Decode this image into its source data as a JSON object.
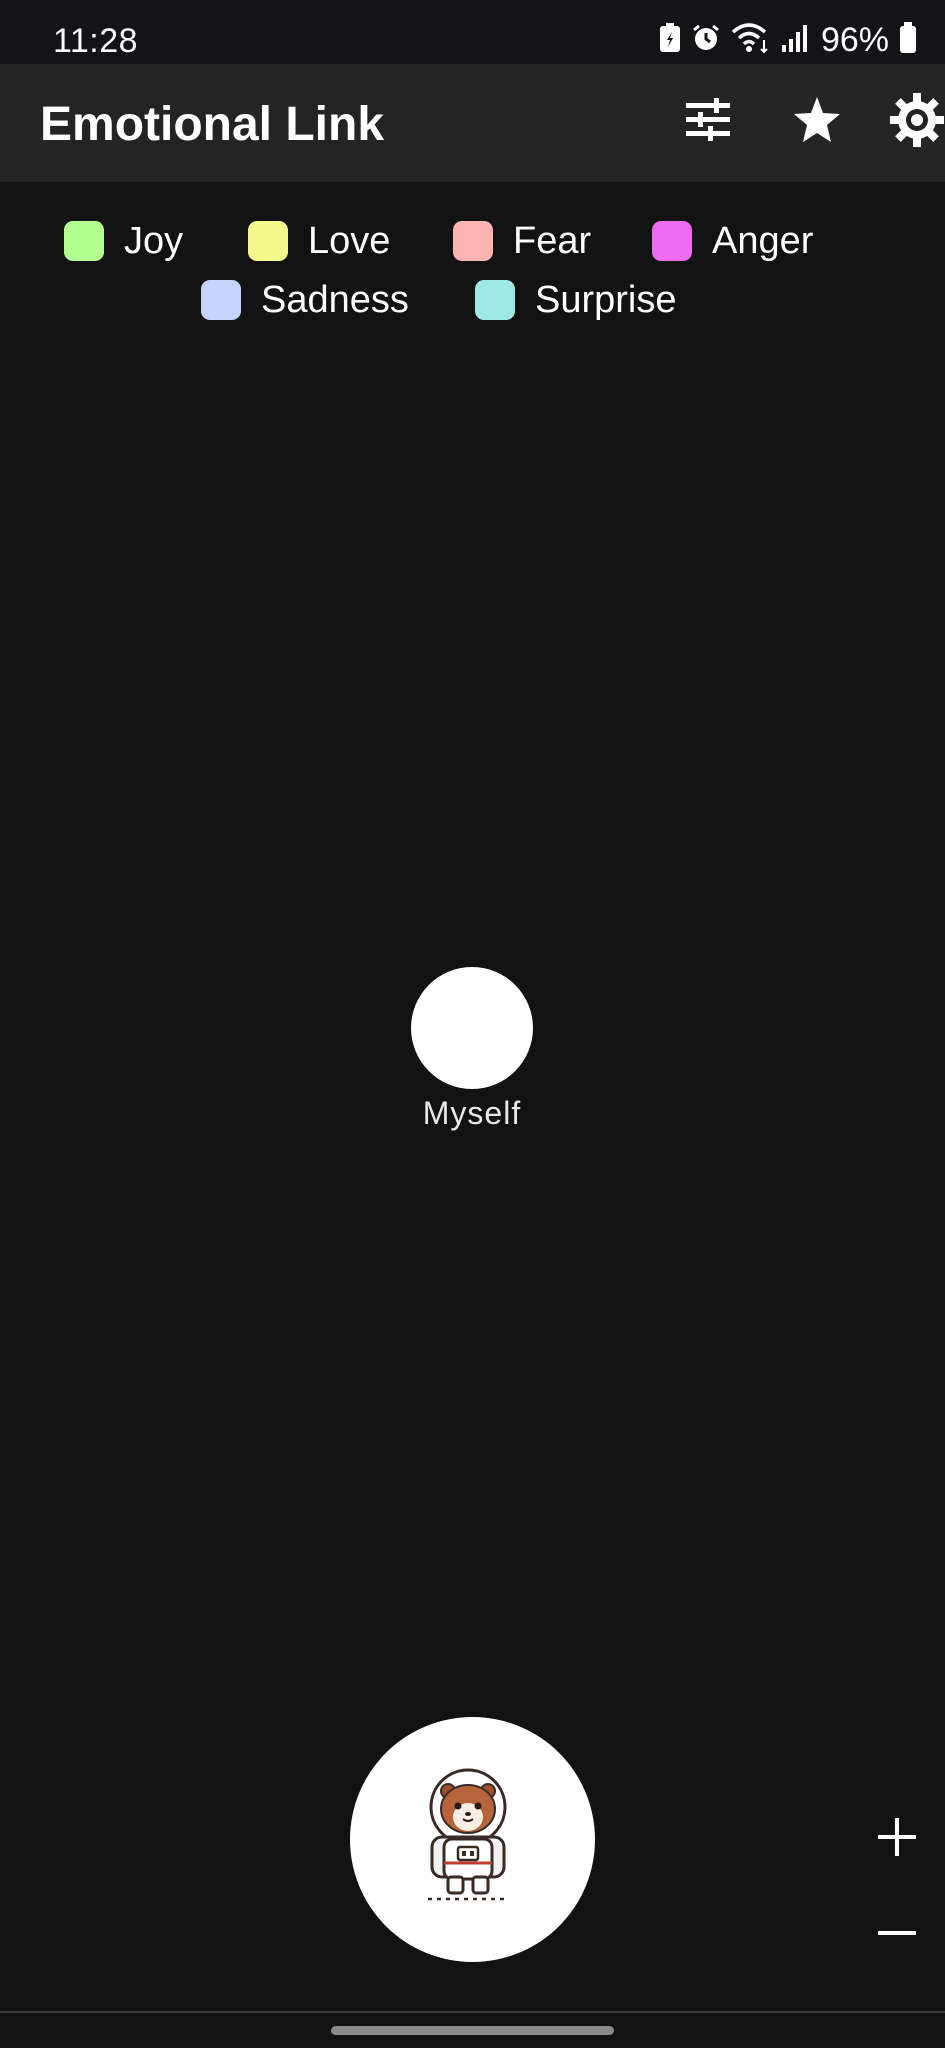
{
  "status_bar": {
    "time": "11:28",
    "battery_percent": "96%",
    "icons": [
      "battery-saver-icon",
      "alarm-icon",
      "wifi-icon",
      "signal-icon",
      "battery-icon"
    ]
  },
  "app_bar": {
    "title": "Emotional Link",
    "actions": [
      "tune-icon",
      "star-icon",
      "settings-icon"
    ]
  },
  "legend": {
    "row1": [
      {
        "label": "Joy",
        "color": "#b3ff8f"
      },
      {
        "label": "Love",
        "color": "#f3f98d"
      },
      {
        "label": "Fear",
        "color": "#ffb3b3"
      },
      {
        "label": "Anger",
        "color": "#f06bf1"
      }
    ],
    "row2": [
      {
        "label": "Sadness",
        "color": "#c3d4ff"
      },
      {
        "label": "Surprise",
        "color": "#9ee8e6"
      }
    ]
  },
  "graph": {
    "node_label": "Myself"
  },
  "fab": {
    "icon": "astronaut-hamster-icon"
  },
  "zoom": {
    "in": "+",
    "out": "–"
  },
  "colors": {
    "background": "#121212",
    "app_bar": "#242424",
    "status_bar": "#131318"
  }
}
